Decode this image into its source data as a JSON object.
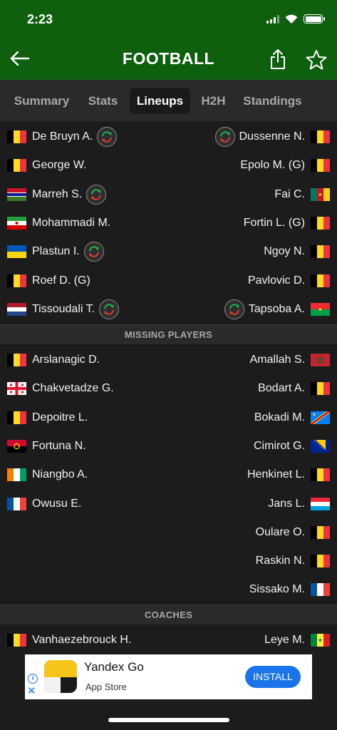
{
  "status": {
    "time": "2:23"
  },
  "header": {
    "title": "FOOTBALL"
  },
  "tabs": [
    "Summary",
    "Stats",
    "Lineups",
    "H2H",
    "Standings"
  ],
  "active_tab": "Lineups",
  "lineups": {
    "left": [
      {
        "name": "De Bruyn A.",
        "flag": "belgium",
        "sub": true
      },
      {
        "name": "George W.",
        "flag": "belgium",
        "sub": false
      },
      {
        "name": "Marreh S.",
        "flag": "gambia",
        "sub": true
      },
      {
        "name": "Mohammadi M.",
        "flag": "iran",
        "sub": false
      },
      {
        "name": "Plastun I.",
        "flag": "ukraine",
        "sub": true
      },
      {
        "name": "Roef D. (G)",
        "flag": "belgium",
        "sub": false
      },
      {
        "name": "Tissoudali T.",
        "flag": "netherlands",
        "sub": true
      }
    ],
    "right": [
      {
        "name": "Dussenne N.",
        "flag": "belgium",
        "sub": true
      },
      {
        "name": "Epolo M. (G)",
        "flag": "belgium",
        "sub": false
      },
      {
        "name": "Fai C.",
        "flag": "cameroon",
        "sub": false
      },
      {
        "name": "Fortin L. (G)",
        "flag": "belgium",
        "sub": false
      },
      {
        "name": "Ngoy N.",
        "flag": "belgium",
        "sub": false
      },
      {
        "name": "Pavlovic D.",
        "flag": "belgium",
        "sub": false
      },
      {
        "name": "Tapsoba A.",
        "flag": "burkina-faso",
        "sub": true
      }
    ]
  },
  "missing": {
    "title": "MISSING PLAYERS",
    "left": [
      {
        "name": "Arslanagic D.",
        "flag": "belgium"
      },
      {
        "name": "Chakvetadze G.",
        "flag": "georgia"
      },
      {
        "name": "Depoitre L.",
        "flag": "belgium"
      },
      {
        "name": "Fortuna N.",
        "flag": "angola"
      },
      {
        "name": "Niangbo A.",
        "flag": "ivory-coast"
      },
      {
        "name": "Owusu E.",
        "flag": "france"
      }
    ],
    "right": [
      {
        "name": "Amallah S.",
        "flag": "morocco"
      },
      {
        "name": "Bodart A.",
        "flag": "belgium"
      },
      {
        "name": "Bokadi M.",
        "flag": "dr-congo"
      },
      {
        "name": "Cimirot G.",
        "flag": "bosnia"
      },
      {
        "name": "Henkinet L.",
        "flag": "belgium"
      },
      {
        "name": "Jans L.",
        "flag": "luxembourg"
      },
      {
        "name": "Oulare O.",
        "flag": "belgium"
      },
      {
        "name": "Raskin N.",
        "flag": "belgium"
      },
      {
        "name": "Sissako M.",
        "flag": "france"
      }
    ]
  },
  "coaches": {
    "title": "COACHES",
    "left": [
      {
        "name": "Vanhaezebrouck H.",
        "flag": "belgium"
      }
    ],
    "right": [
      {
        "name": "Leye M.",
        "flag": "senegal"
      }
    ]
  },
  "ad": {
    "title": "Yandex Go",
    "subtitle": "App Store",
    "cta": "INSTALL",
    "info_glyph": "i",
    "close_glyph": "✕"
  },
  "icons": {
    "back": "arrow-left-icon",
    "share": "share-icon",
    "favorite": "star-outline-icon",
    "substitution": "substitution-icon"
  },
  "colors": {
    "header_bg": "#0e5f0e",
    "page_bg": "#1c1c1c",
    "tab_bar_bg": "#2a2a2a",
    "install_button": "#1a73e8"
  }
}
